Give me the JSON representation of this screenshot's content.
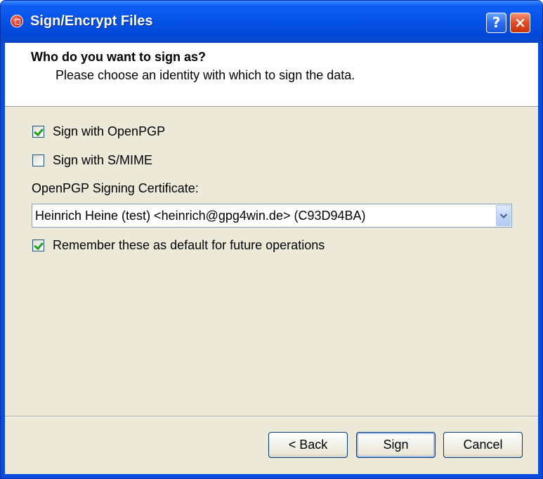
{
  "window": {
    "title": "Sign/Encrypt Files",
    "help_symbol": "?",
    "close_symbol": "×"
  },
  "header": {
    "title": "Who do you want to sign as?",
    "subtitle": "Please choose an identity with which to sign the data."
  },
  "options": {
    "sign_openpgp": {
      "label": "Sign with OpenPGP",
      "checked": true
    },
    "sign_smime": {
      "label": "Sign with S/MIME",
      "checked": false
    },
    "remember_default": {
      "label": "Remember these as default for future operations",
      "checked": true
    }
  },
  "certificate": {
    "label": "OpenPGP Signing Certificate:",
    "selected": "Heinrich Heine (test) <heinrich@gpg4win.de> (C93D94BA)"
  },
  "buttons": {
    "back": "< Back",
    "sign": "Sign",
    "cancel": "Cancel"
  },
  "colors": {
    "titlebar": "#0653e8",
    "dialog_bg": "#ece9d8",
    "check_mark": "#21a121",
    "close_button": "#e04a22"
  },
  "icons": {
    "app": "gpg4win-app-icon",
    "help": "help-icon",
    "close": "close-icon",
    "dropdown": "chevron-down-icon"
  }
}
